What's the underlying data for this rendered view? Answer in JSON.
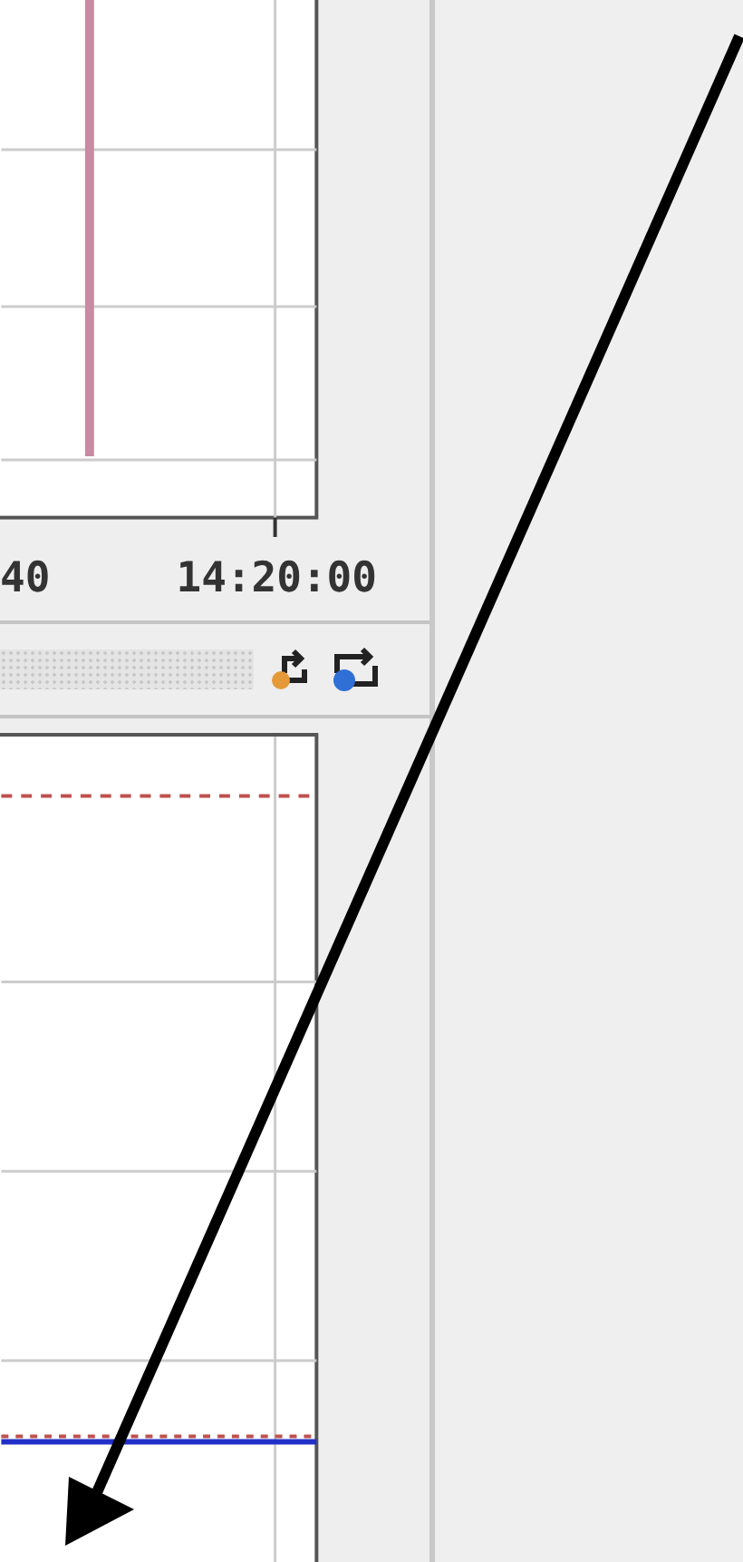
{
  "top_chart": {
    "x_axis_labels": [
      "40",
      "14:20:00"
    ]
  }
}
